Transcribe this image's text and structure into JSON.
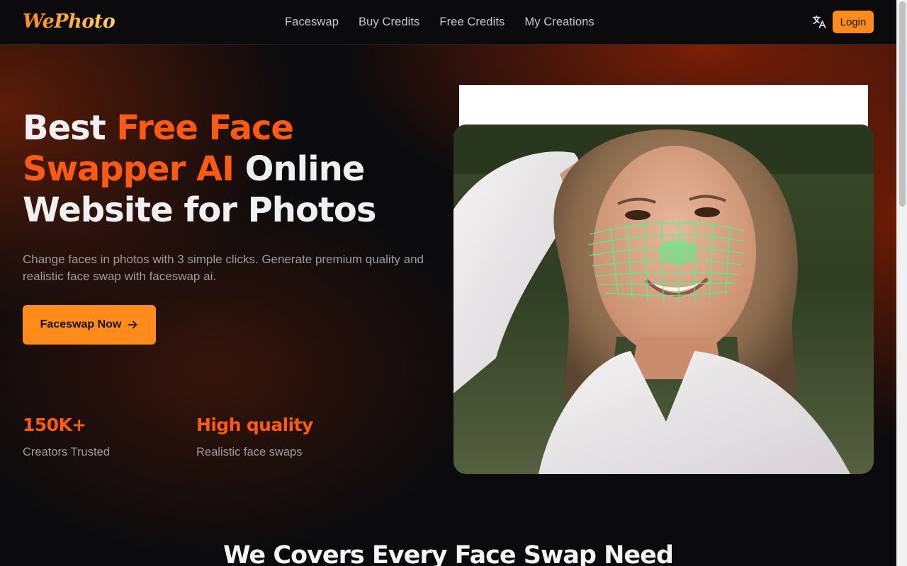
{
  "brand": {
    "logo_text": "WePhoto"
  },
  "nav": {
    "items": [
      {
        "label": "Faceswap"
      },
      {
        "label": "Buy Credits"
      },
      {
        "label": "Free Credits"
      },
      {
        "label": "My Creations"
      }
    ],
    "language_icon": "translate-icon",
    "login_label": "Login"
  },
  "hero": {
    "headline": {
      "part1": "Best ",
      "accent": "Free Face Swapper AI",
      "part2": " Online Website for Photos"
    },
    "subtext": "Change faces in photos with 3 simple clicks. Generate premium quality and realistic face swap with faceswap ai.",
    "cta_label": "Faceswap Now",
    "cta_icon": "arrow-right-icon",
    "stats": [
      {
        "value": "150K+",
        "label": "Creators Trusted"
      },
      {
        "value": "High quality",
        "label": "Realistic face swaps"
      }
    ]
  },
  "section": {
    "title": "We Covers Every Face Swap Need"
  },
  "colors": {
    "accent_orange": "#ff8c1a",
    "accent_red_orange": "#ff5a12",
    "background": "#0b0b0d",
    "mesh_green": "#3cff8a"
  }
}
